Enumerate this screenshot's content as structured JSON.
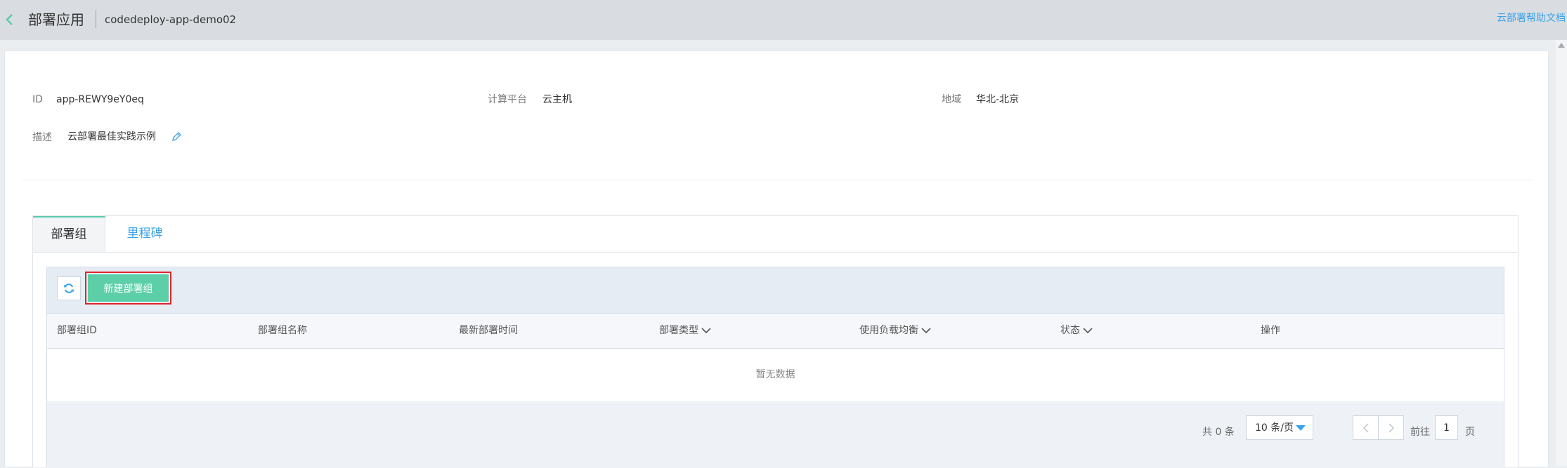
{
  "header": {
    "title": "部署应用",
    "app_name": "codedeploy-app-demo02",
    "help_link": "云部署帮助文档"
  },
  "info": {
    "id_label": "ID",
    "id_value": "app-REWY9eY0eq",
    "platform_label": "计算平台",
    "platform_value": "云主机",
    "region_label": "地域",
    "region_value": "华北-北京",
    "desc_label": "描述",
    "desc_value": "云部署最佳实践示例"
  },
  "tabs": [
    {
      "label": "部署组",
      "active": true
    },
    {
      "label": "里程碑",
      "active": false
    }
  ],
  "toolbar": {
    "new_button": "新建部署组"
  },
  "table": {
    "columns": [
      "部署组ID",
      "部署组名称",
      "最新部署时间",
      "部署类型",
      "使用负载均衡",
      "状态",
      "操作"
    ],
    "empty_text": "暂无数据"
  },
  "pagination": {
    "total": "共 0 条",
    "page_size": "10 条/页",
    "goto_label": "前往",
    "current_page": "1",
    "page_unit": "页"
  },
  "colors": {
    "accent_green": "#5ccfa9",
    "link_blue": "#3ba3e8",
    "highlight_red": "#e0242a"
  }
}
